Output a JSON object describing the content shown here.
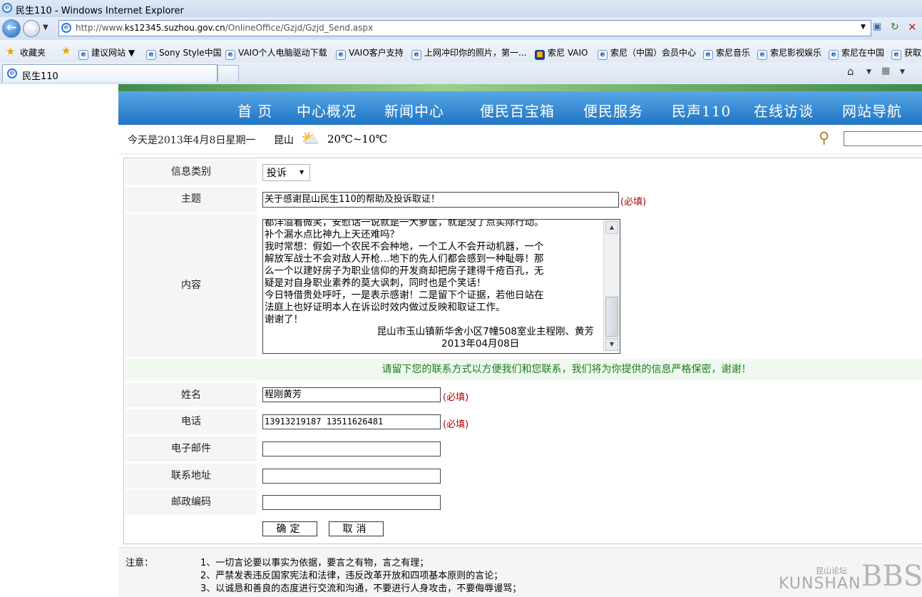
{
  "browser": {
    "window_title": "民生110 - Windows Internet Explorer",
    "url_prefix": "http://www.",
    "url_domain": "ks12345.suzhou.gov.cn",
    "url_path": "/OnlineOffice/Gzjd/Gzjd_Send.aspx",
    "favorites_label": "收藏夹",
    "favorites": [
      "建议网站 ▼",
      "Sony Style中国",
      "VAIO个人电脑驱动下载",
      "VAIO客户支持",
      "上网冲印你的照片，第一...",
      "索尼 VAIO",
      "索尼（中国）会员中心",
      "索尼音乐",
      "索尼影视娱乐",
      "索尼在中国",
      "获取更"
    ],
    "tab_title": "民生110"
  },
  "site": {
    "nav": [
      "首 页",
      "中心概况",
      "新闻中心",
      "便民百宝箱",
      "便民服务",
      "民声110",
      "在线访谈",
      "网站导航"
    ],
    "date": "今天是2013年4月8日星期一",
    "city": "昆山",
    "temperature": "20℃~10℃",
    "weather_icon": "partly-cloudy-icon"
  },
  "form": {
    "category": {
      "label": "信息类别",
      "value": "投诉"
    },
    "subject": {
      "label": "主题",
      "value": "关于感谢昆山民生110的帮助及投诉取证！",
      "required": "(必填)"
    },
    "content": {
      "label": "内容",
      "lines": [
        "都洋溢着微笑，安慰话一说就是一大箩筐，就是没了点实际行动。",
        "补个漏水点比神九上天还难吗？",
        "我时常想：假如一个农民不会种地，一个工人不会开动机器，一个",
        "解放军战士不会对敌人开枪…地下的先人们都会感到一种耻辱！那",
        "么一个以建好房子为职业信仰的开发商却把房子建得千疮百孔，无",
        "疑是对自身职业素养的莫大讽刺，同时也是个笑话！",
        "今日特借贵处呼吁，一是表示感谢！二是留下个证据，若他日站在",
        "法庭上也好证明本人在诉讼时效内做过反映和取证工作。",
        "谢谢了！"
      ],
      "signature": "昆山市玉山镇新华舍小区7幢508室业主程刚、黄芳",
      "sign_date": "2013年04月08日"
    },
    "notice": "请留下您的联系方式以方便我们和您联系，我们将为你提供的信息严格保密，谢谢！",
    "name": {
      "label": "姓名",
      "value": "程刚黄芳",
      "required": "(必填)"
    },
    "phone": {
      "label": "电话",
      "value": "13913219187 13511626481",
      "required": "(必填)"
    },
    "email": {
      "label": "电子邮件",
      "value": ""
    },
    "address": {
      "label": "联系地址",
      "value": ""
    },
    "postcode": {
      "label": "邮政编码",
      "value": ""
    },
    "submit_label": "确定",
    "cancel_label": "取消"
  },
  "notes": {
    "label": "注意：",
    "items": [
      "1、一切言论要以事实为依据，要言之有物，言之有理；",
      "2、严禁发表违反国家宪法和法律，违反改革开放和四项基本原则的言论；",
      "3、以诚恳和善良的态度进行交流和沟通，不要进行人身攻击，不要侮辱谩骂；"
    ]
  },
  "watermark": {
    "text": "KUNSHAN",
    "small": "昆山论坛",
    "big": "BBS"
  }
}
